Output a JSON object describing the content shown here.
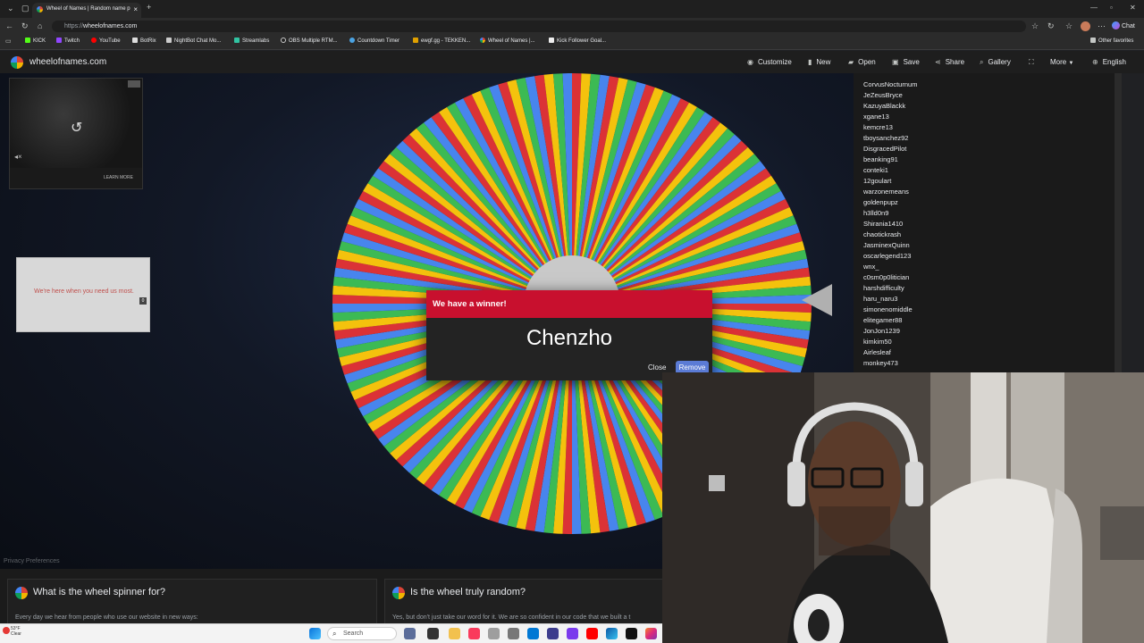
{
  "browser": {
    "tab_title": "Wheel of Names | Random name p",
    "url_scheme": "https://",
    "url_host": "wheelofnames.com",
    "profile_label": "Chat",
    "bookmarks": [
      "KICK",
      "Twitch",
      "YouTube",
      "BotRix",
      "NightBot Chat Mo...",
      "Streamlabs",
      "OBS Multiple RTM...",
      "Countdown Timer",
      "ewgf.gg - TEKKEN...",
      "Wheel of Names |...",
      "Kick Follower Goal..."
    ],
    "other_favorites": "Other favorites"
  },
  "site": {
    "name": "wheelofnames.com",
    "menu": {
      "customize": "Customize",
      "new": "New",
      "open": "Open",
      "save": "Save",
      "share": "Share",
      "gallery": "Gallery",
      "more": "More",
      "language": "English"
    }
  },
  "ads": {
    "video_learn_more": "LEARN MORE",
    "banner_text": "We're here when you need us most.",
    "banner_badge": "0"
  },
  "entries": [
    "CorvusNocturnum",
    "JeZeusBryce",
    "KazuyaBlackk",
    "xgane13",
    "kemcre13",
    "tboysanchez92",
    "DisgracedPilot",
    "beanking91",
    "conteki1",
    "12goulart",
    "warzonemeans",
    "goldenpupz",
    "h3lld0n9",
    "Shirania1410",
    "chaotickrash",
    "JasminexQuinn",
    "oscarlegend123",
    "wnx_",
    "c0sm0p0litician",
    "harshdifficulty",
    "haru_naru3",
    "simonenomiddle",
    "elitegamer88",
    "JonJon1239",
    "kimkim50",
    "Airlesleaf",
    "monkey473"
  ],
  "dialog": {
    "heading": "We have a winner!",
    "winner": "Chenzho",
    "close_label": "Close",
    "remove_label": "Remove"
  },
  "privacy_link": "Privacy Preferences",
  "info_cards": [
    {
      "title": "What is the wheel spinner for?",
      "body": "Every day we hear from people who use our website in new ways:"
    },
    {
      "title": "Is the wheel truly random?",
      "body": "Yes, but don't just take our word for it. We are so confident in our code that we built a t"
    }
  ],
  "taskbar": {
    "weather_temp": "53°F",
    "weather_desc": "Clear",
    "search_placeholder": "Search"
  },
  "colors": {
    "wheel_red": "#db3236",
    "wheel_yellow": "#f4c20d",
    "wheel_green": "#3cba54",
    "wheel_blue": "#4885ed",
    "dialog_header": "#c8102e",
    "remove_button": "#5b7bd5"
  }
}
